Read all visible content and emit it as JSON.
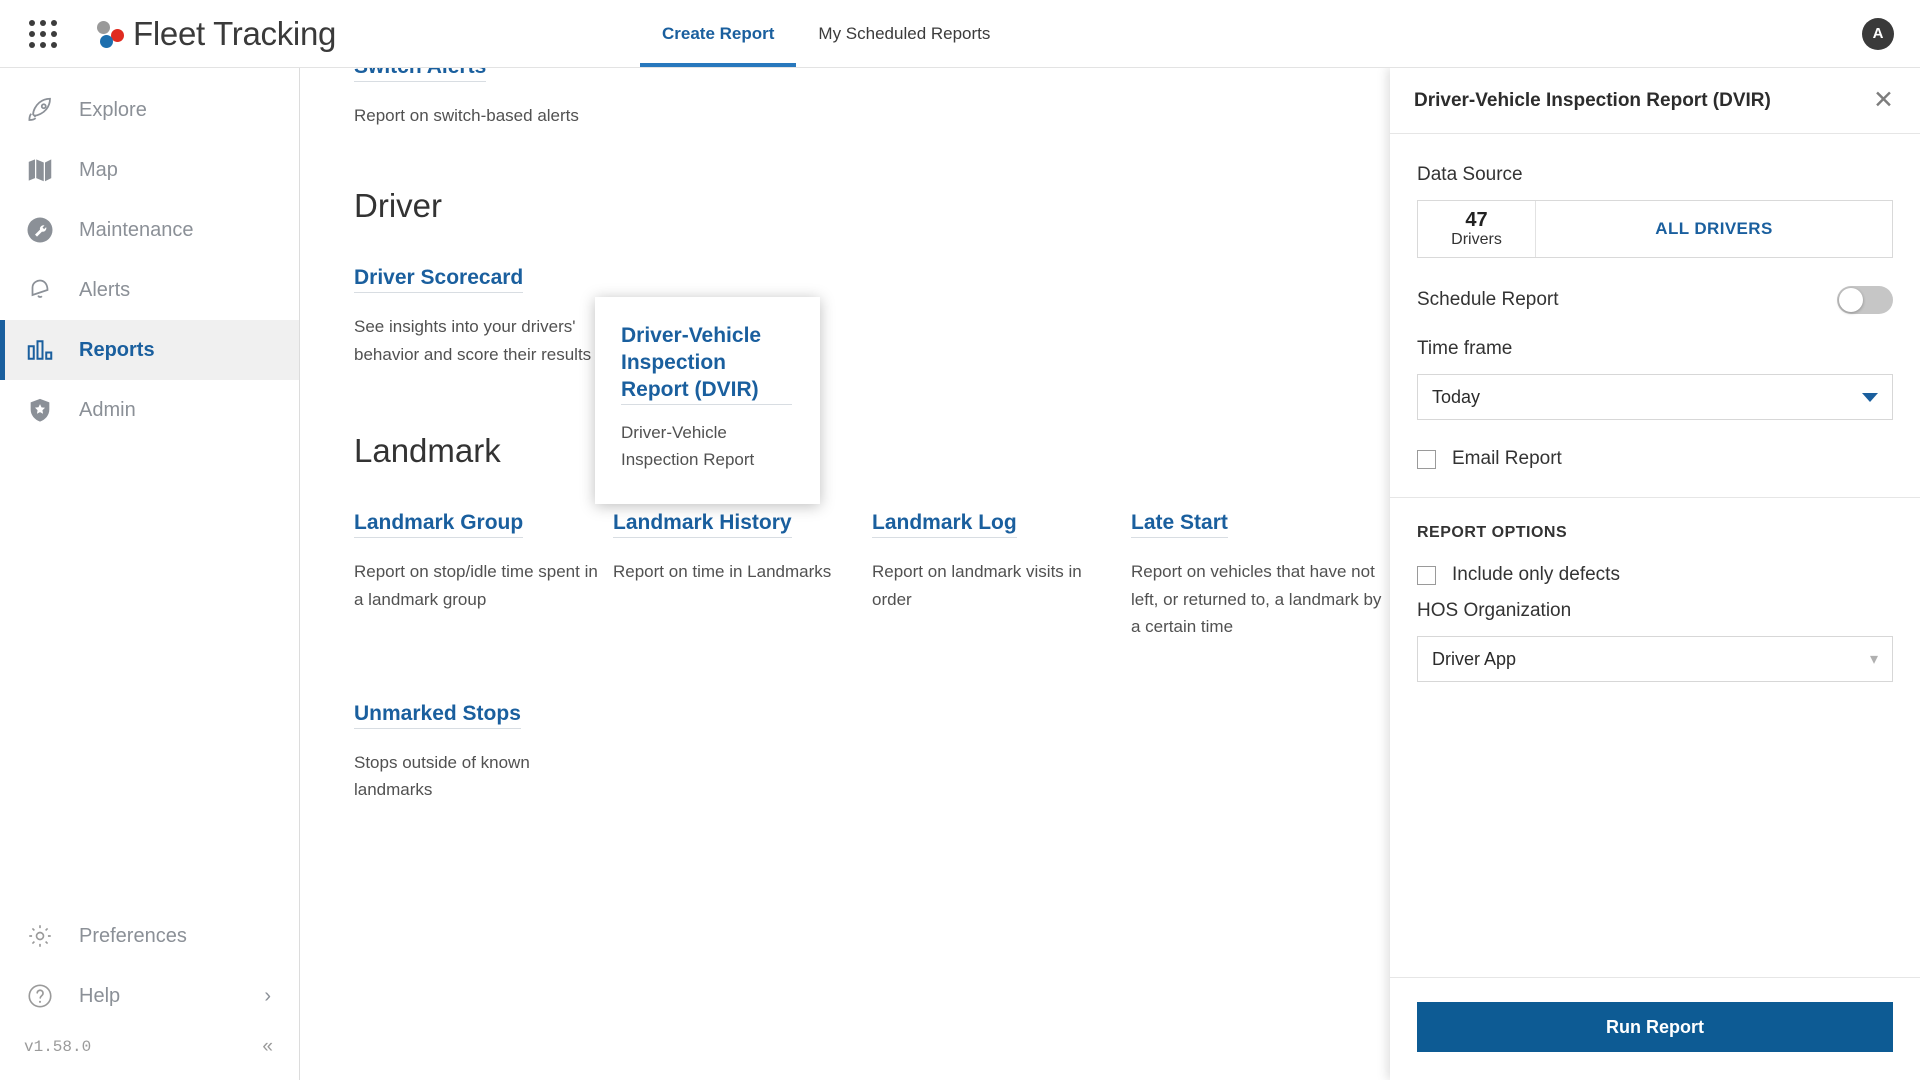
{
  "header": {
    "app_launcher_icon": "grid-apps-icon",
    "brand": "Fleet Tracking",
    "brand_colors": {
      "gray": "#9a9a9a",
      "red": "#e02b20",
      "blue": "#1d6fae"
    },
    "tabs": [
      {
        "label": "Create Report",
        "active": true
      },
      {
        "label": "My Scheduled Reports",
        "active": false
      }
    ],
    "avatar_initial": "A"
  },
  "sidebar": {
    "items": [
      {
        "label": "Explore",
        "icon": "rocket-icon",
        "active": false
      },
      {
        "label": "Map",
        "icon": "map-icon",
        "active": false
      },
      {
        "label": "Maintenance",
        "icon": "wrench-icon",
        "active": false
      },
      {
        "label": "Alerts",
        "icon": "bell-icon",
        "active": false
      },
      {
        "label": "Reports",
        "icon": "bar-chart-icon",
        "active": true
      },
      {
        "label": "Admin",
        "icon": "shield-star-icon",
        "active": false
      }
    ],
    "bottom_items": [
      {
        "label": "Preferences",
        "icon": "gear-icon"
      },
      {
        "label": "Help",
        "icon": "question-circle-icon"
      }
    ],
    "version": "v1.58.0",
    "collapse_icon": "double-chevron-left-icon"
  },
  "main": {
    "top_partial_card": {
      "title": "Switch Alerts",
      "desc": "Report on switch-based alerts"
    },
    "sections": [
      {
        "title": "Driver",
        "cards": [
          {
            "title": "Driver Scorecard",
            "desc": "See insights into your drivers' behavior and score their results"
          }
        ]
      },
      {
        "title": "Landmark",
        "cards": [
          {
            "title": "Landmark Group",
            "desc": "Report on stop/idle time spent in a landmark group"
          },
          {
            "title": "Landmark History",
            "desc": "Report on time in Landmarks"
          },
          {
            "title": "Landmark Log",
            "desc": "Report on landmark visits in order"
          },
          {
            "title": "Late Start",
            "desc": "Report on vehicles that have not left, or returned to, a landmark by a certain time"
          }
        ],
        "cards_row2": [
          {
            "title": "Unmarked Stops",
            "desc": "Stops outside of known landmarks"
          }
        ]
      }
    ],
    "hovered_card": {
      "title": "Driver-Vehicle Inspection Report (DVIR)",
      "desc": "Driver-Vehicle Inspection Report"
    }
  },
  "panel": {
    "title": "Driver-Vehicle Inspection Report (DVIR)",
    "close_icon": "close-icon",
    "data_source_label": "Data Source",
    "data_source": {
      "count": "47",
      "unit": "Drivers",
      "selection": "ALL DRIVERS"
    },
    "schedule_label": "Schedule Report",
    "schedule_enabled": false,
    "timeframe_label": "Time frame",
    "timeframe_value": "Today",
    "email_label": "Email Report",
    "email_checked": false,
    "options_heading": "REPORT OPTIONS",
    "include_defects_label": "Include only defects",
    "include_defects_checked": false,
    "hos_label": "HOS Organization",
    "hos_value": "Driver App",
    "run_button": "Run Report",
    "accent_color": "#0d5b94"
  }
}
